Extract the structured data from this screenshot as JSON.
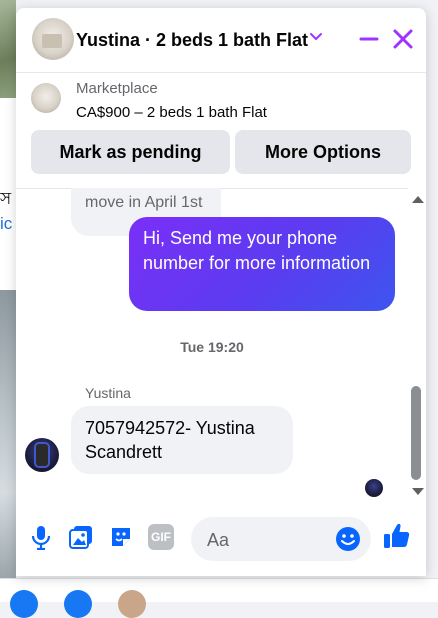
{
  "colors": {
    "accent": "#a033ff",
    "brand_blue": "#0866ff",
    "bubble_gradient": [
      "#7b2ff7",
      "#3d55ef"
    ]
  },
  "background": {
    "text_line1": "স",
    "text_line2": "ic"
  },
  "header": {
    "title": "Yustina · 2 beds 1 bath Flat",
    "icons": [
      "chevron-down-icon",
      "minimize-icon",
      "close-icon"
    ]
  },
  "marketplace": {
    "label": "Marketplace",
    "item": "CA$900 – 2 beds 1 bath Flat",
    "mark_pending_label": "Mark as pending",
    "more_options_label": "More Options"
  },
  "messages": {
    "previous_tail": "move in April 1st",
    "outgoing": "Hi, Send me your phone number for more information",
    "timestamp": "Tue 19:20",
    "sender_name": "Yustina",
    "incoming": "7057942572- Yustina Scandrett"
  },
  "composer": {
    "placeholder": "Aa",
    "icons": [
      "microphone-icon",
      "photo-icon",
      "sticker-icon",
      "gif-icon",
      "emoji-icon",
      "like-icon"
    ],
    "gif_label": "GIF"
  }
}
